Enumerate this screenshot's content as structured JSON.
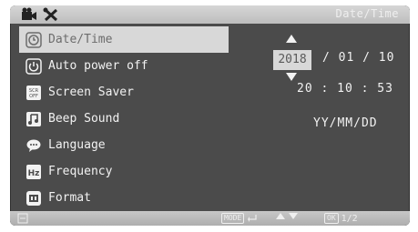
{
  "header": {
    "title": "Date/Time",
    "icons": [
      {
        "name": "camcorder-icon"
      },
      {
        "name": "tools-icon"
      }
    ]
  },
  "menu": {
    "items": [
      {
        "label": "Date/Time",
        "icon": "clock-icon",
        "selected": true
      },
      {
        "label": "Auto power off",
        "icon": "power-icon",
        "selected": false
      },
      {
        "label": "Screen Saver",
        "icon": "screensaver-icon",
        "selected": false
      },
      {
        "label": "Beep Sound",
        "icon": "music-note-icon",
        "selected": false
      },
      {
        "label": "Language",
        "icon": "speech-bubble-icon",
        "selected": false
      },
      {
        "label": "Frequency",
        "icon": "hz-icon",
        "selected": false
      },
      {
        "label": "Format",
        "icon": "memory-card-icon",
        "selected": false
      }
    ]
  },
  "datetime": {
    "year": "2018",
    "date_rest": "/ 01 / 10",
    "time": "20 : 10 : 53",
    "format": "YY/MM/DD"
  },
  "footer": {
    "mode_label": "MODE",
    "ok_label": "OK",
    "page": "1/2"
  },
  "colors": {
    "screen_bg": "#4b4b4b",
    "selection_bg": "#d8d8d8",
    "text": "#f2f2f2"
  }
}
